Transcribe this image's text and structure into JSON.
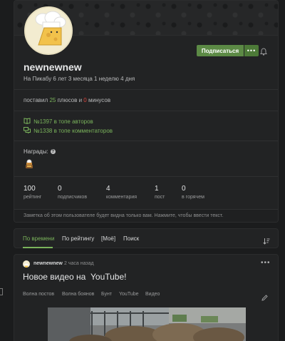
{
  "profile": {
    "subscribe_label": "Подписаться",
    "more_label": "•••",
    "username": "newnewnew",
    "member_since": "На Пикабу 6 лет 3 месяца 1 неделю 4 дня",
    "pluses_prefix": "поставил",
    "pluses_count": "25",
    "pluses_middle": "плюсов и",
    "minuses_count": "0",
    "minuses_suffix": "минусов",
    "top_authors": "№1397 в топе авторов",
    "top_commenters": "№1338 в топе комментаторов",
    "awards_label": "Награды:",
    "help_glyph": "?",
    "stats": [
      {
        "value": "100",
        "label": "рейтинг"
      },
      {
        "value": "0",
        "label": "подписчиков"
      },
      {
        "value": "4",
        "label": "комментария"
      },
      {
        "value": "1",
        "label": "пост"
      },
      {
        "value": "0",
        "label": "в горячем"
      }
    ],
    "note": "Заметка об этом пользователе будет видна только вам. Нажмите, чтобы ввести текст."
  },
  "tabs": [
    {
      "label": "По времени",
      "active": true
    },
    {
      "label": "По рейтингу",
      "active": false
    },
    {
      "label": "[Моё]",
      "active": false
    },
    {
      "label": "Поиск",
      "active": false
    }
  ],
  "post": {
    "author": "newnewnew",
    "time": "2 часа назад",
    "menu_label": "•••",
    "title": "Новое видео на  YouTube!",
    "tags": [
      "Волна постов",
      "Волна боянов",
      "Бунт",
      "YouTube",
      "Видео"
    ]
  },
  "colors": {
    "accent_green": "#7ab35b",
    "minus_red": "#d9453d",
    "button_green": "#5c8a45"
  },
  "icons": [
    "bell-icon",
    "book-icon",
    "comments-icon",
    "help-icon",
    "sort-icon",
    "edit-icon",
    "award-icon"
  ]
}
